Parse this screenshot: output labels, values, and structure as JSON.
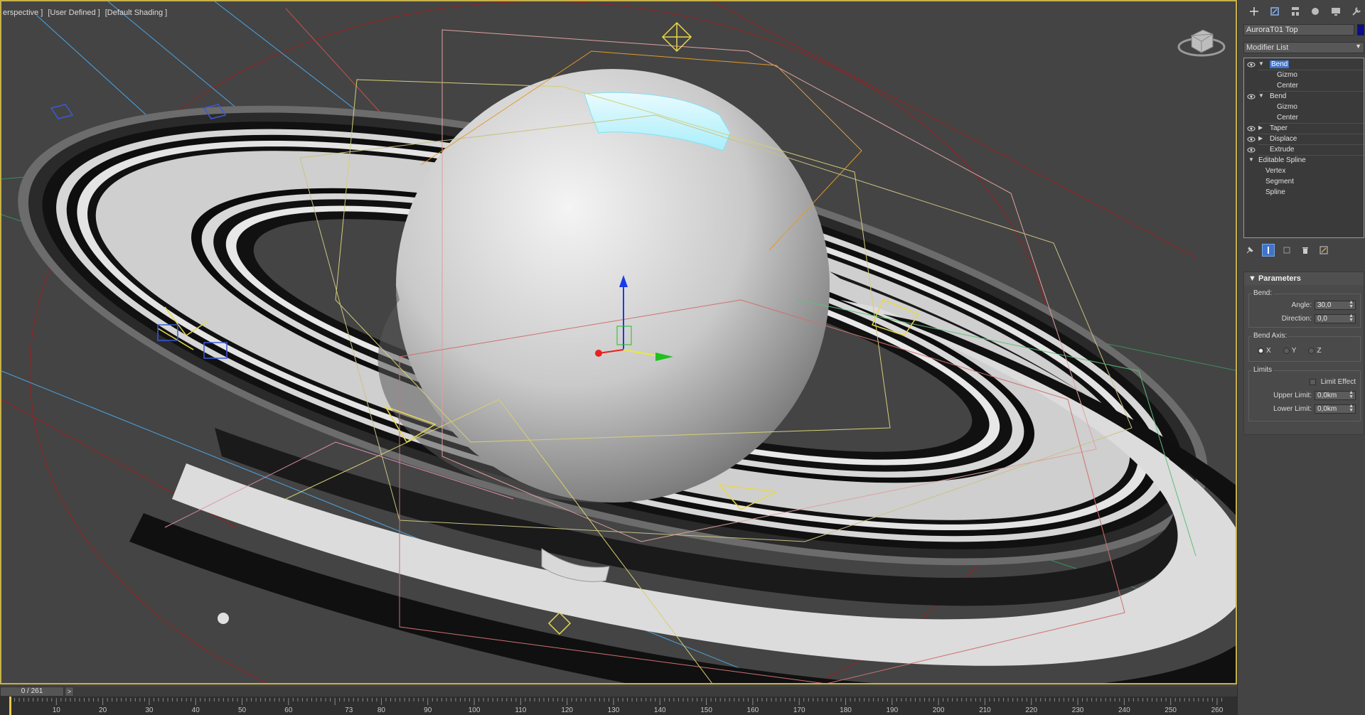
{
  "viewport": {
    "labels": [
      "erspective ]",
      "[User Defined ]",
      "[Default Shading ]"
    ]
  },
  "command_panel": {
    "tabs": [
      "create-icon",
      "modify-icon",
      "hierarchy-icon",
      "motion-icon",
      "display-icon",
      "utilities-icon"
    ],
    "object_name": "AuroraT01 Top",
    "object_color": "#0c0c8c",
    "modifier_list_label": "Modifier List",
    "stack": [
      {
        "label": "Bend",
        "selected": true
      },
      {
        "label": "Gizmo"
      },
      {
        "label": "Center"
      },
      {
        "label": "Bend"
      },
      {
        "label": "Gizmo"
      },
      {
        "label": "Center"
      },
      {
        "label": "Taper"
      },
      {
        "label": "Displace"
      },
      {
        "label": "Extrude"
      },
      {
        "label": "Editable Spline"
      },
      {
        "label": "Vertex"
      },
      {
        "label": "Segment"
      },
      {
        "label": "Spline"
      }
    ]
  },
  "parameters": {
    "title": "Parameters",
    "bend_label": "Bend:",
    "angle_label": "Angle:",
    "angle_value": "30,0",
    "direction_label": "Direction:",
    "direction_value": "0,0",
    "bend_axis_label": "Bend Axis:",
    "axes": [
      "X",
      "Y",
      "Z"
    ],
    "selected_axis": "X",
    "limits_label": "Limits",
    "limit_effect_label": "Limit Effect",
    "upper_limit_label": "Upper Limit:",
    "upper_limit_value": "0,0km",
    "lower_limit_label": "Lower Limit:",
    "lower_limit_value": "0,0km"
  },
  "timeline": {
    "frame_display": "0 / 261",
    "next_label": ">",
    "current_frame": 0,
    "total_frames": 261,
    "ticks": [
      "10",
      "20",
      "30",
      "40",
      "50",
      "60",
      "73",
      "80",
      "90",
      "100",
      "110",
      "120",
      "130",
      "140",
      "150",
      "160",
      "170",
      "180",
      "190",
      "200",
      "210",
      "220",
      "230",
      "240",
      "250",
      "260"
    ]
  },
  "colors": {
    "viewport_border": "#c6b04a",
    "selection": "#3f74c9"
  }
}
